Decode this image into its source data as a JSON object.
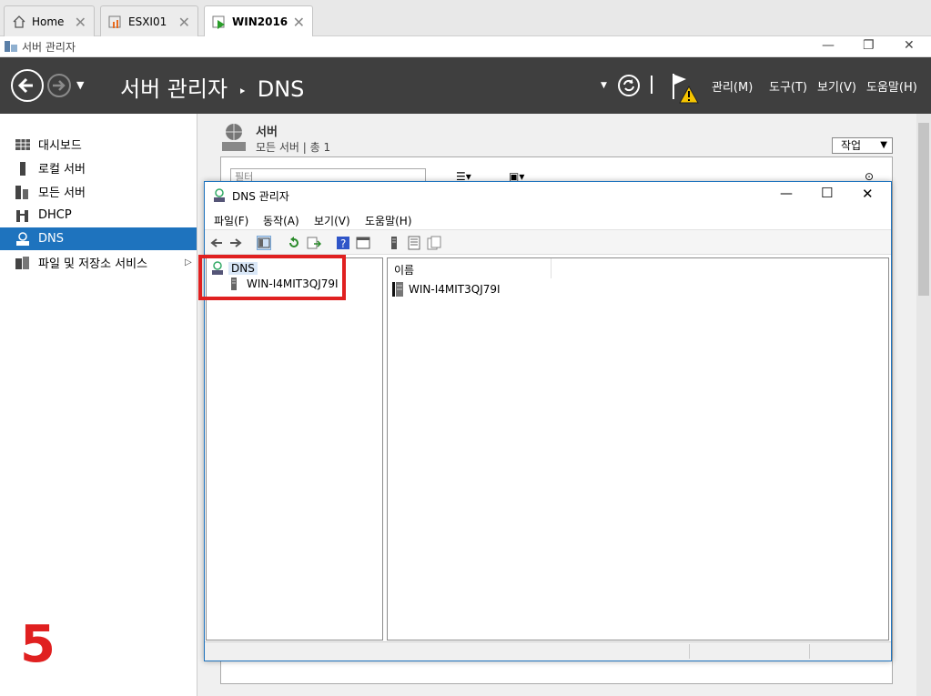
{
  "browser_tabs": [
    {
      "label": "Home",
      "icon": "home-icon"
    },
    {
      "label": "ESXI01",
      "icon": "esxi-icon"
    },
    {
      "label": "WIN2016",
      "icon": "console-play-icon"
    }
  ],
  "window": {
    "title": "서버 관리자"
  },
  "header": {
    "title": "서버 관리자",
    "separator": "‣",
    "page": "DNS",
    "menus": [
      "관리(M)",
      "도구(T)",
      "보기(V)",
      "도움말(H)"
    ]
  },
  "sidebar": {
    "items": [
      {
        "label": "대시보드",
        "icon": "dashboard-icon"
      },
      {
        "label": "로컬 서버",
        "icon": "local-server-icon"
      },
      {
        "label": "모든 서버",
        "icon": "all-servers-icon"
      },
      {
        "label": "DHCP",
        "icon": "dhcp-icon"
      },
      {
        "label": "DNS",
        "icon": "dns-icon",
        "selected": true
      },
      {
        "label": "파일 및 저장소 서비스",
        "icon": "file-storage-icon",
        "arrow": "▷"
      }
    ]
  },
  "servers_section": {
    "title": "서버",
    "subtitle": "모든 서버 | 총 1",
    "task_button": "작업",
    "filter_placeholder": "필터"
  },
  "dns_window": {
    "title": "DNS 관리자",
    "menu": [
      "파일(F)",
      "동작(A)",
      "보기(V)",
      "도움말(H)"
    ],
    "tree": {
      "root": "DNS",
      "child": "WIN-I4MIT3QJ79I"
    },
    "list": {
      "column_header": "이름",
      "rows": [
        "WIN-I4MIT3QJ79I"
      ]
    }
  },
  "annotation": {
    "step_number": "5",
    "highlight_color": "#e02020"
  },
  "colors": {
    "accent": "#1e73be",
    "header_bg": "#3f3f3f"
  }
}
